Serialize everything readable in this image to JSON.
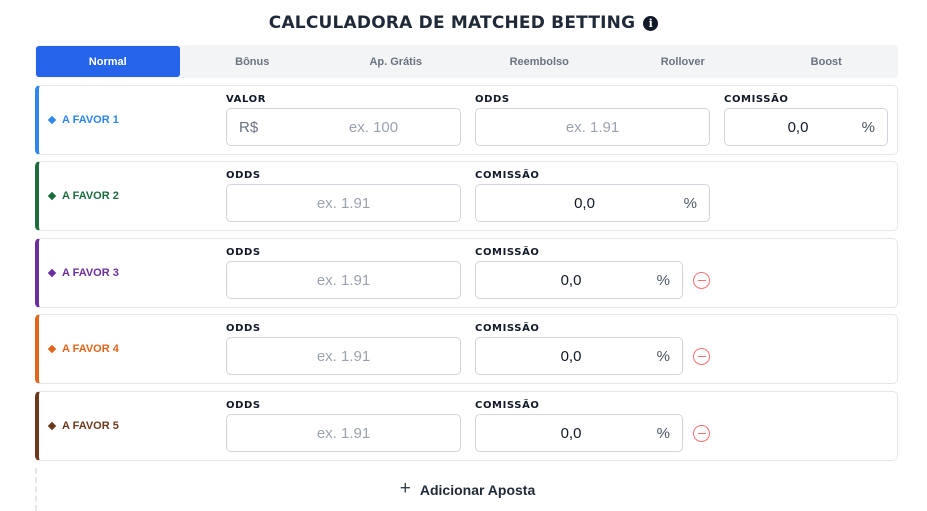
{
  "header": {
    "title": "CALCULADORA DE MATCHED BETTING",
    "info_icon": "i"
  },
  "tabs": [
    {
      "label": "Normal",
      "active": true
    },
    {
      "label": "Bônus",
      "active": false
    },
    {
      "label": "Ap. Grátis",
      "active": false
    },
    {
      "label": "Reembolso",
      "active": false
    },
    {
      "label": "Rollover",
      "active": false
    },
    {
      "label": "Boost",
      "active": false
    }
  ],
  "colors": {
    "accent": "#2563eb",
    "favor1": "#2f86eb",
    "favor2": "#1e6b3e",
    "favor3": "#6b2fa0",
    "favor4": "#e0661b",
    "favor5": "#6b3a1d",
    "remove": "#f87171"
  },
  "bets": [
    {
      "label": "A FAVOR 1",
      "valor": {
        "label": "VALOR",
        "prefix": "R$",
        "placeholder": "ex. 100"
      },
      "odds": {
        "label": "ODDS",
        "placeholder": "ex. 1.91"
      },
      "comissao": {
        "label": "COMISSÃO",
        "value": "0,0",
        "suffix": "%"
      }
    },
    {
      "label": "A FAVOR 2",
      "odds": {
        "label": "ODDS",
        "placeholder": "ex. 1.91"
      },
      "comissao": {
        "label": "COMISSÃO",
        "value": "0,0",
        "suffix": "%"
      }
    },
    {
      "label": "A FAVOR 3",
      "odds": {
        "label": "ODDS",
        "placeholder": "ex. 1.91"
      },
      "comissao": {
        "label": "COMISSÃO",
        "value": "0,0",
        "suffix": "%"
      }
    },
    {
      "label": "A FAVOR 4",
      "odds": {
        "label": "ODDS",
        "placeholder": "ex. 1.91"
      },
      "comissao": {
        "label": "COMISSÃO",
        "value": "0,0",
        "suffix": "%"
      }
    },
    {
      "label": "A FAVOR 5",
      "odds": {
        "label": "ODDS",
        "placeholder": "ex. 1.91"
      },
      "comissao": {
        "label": "COMISSÃO",
        "value": "0,0",
        "suffix": "%"
      }
    }
  ],
  "add_bet": {
    "icon": "+",
    "label": "Adicionar Aposta"
  }
}
